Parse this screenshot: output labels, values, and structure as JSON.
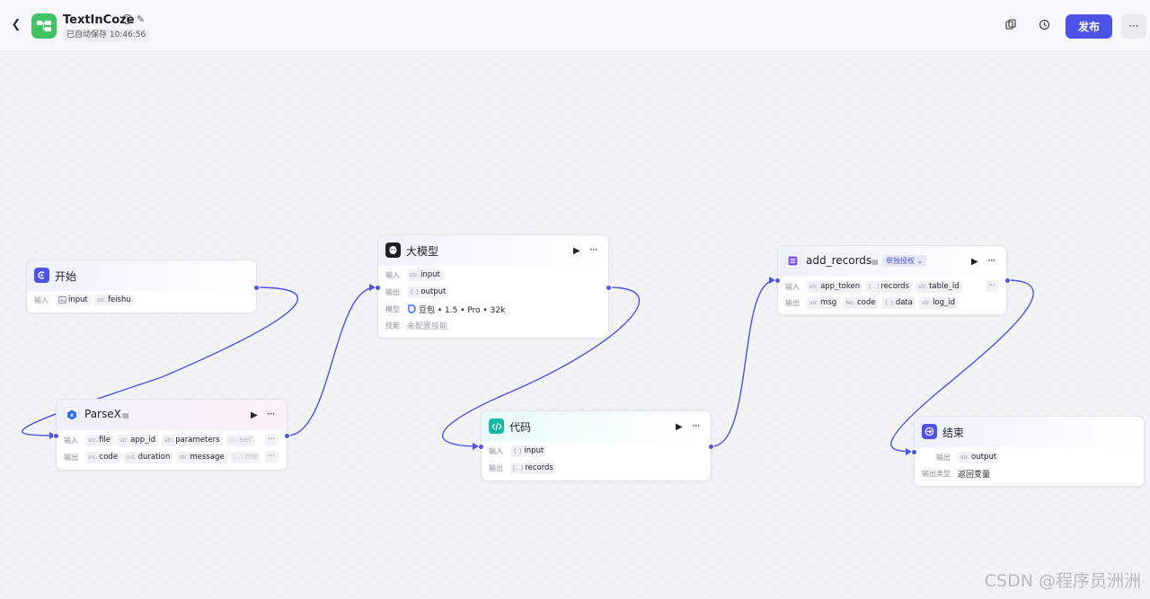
{
  "header": {
    "title": "TextInCoze",
    "autosave": "已自动保存 10:46:56",
    "publish_label": "发布"
  },
  "colors": {
    "accent": "#4d53e8",
    "start": "#4d53e8",
    "llm": "#1d1f29",
    "code": "#16b8a6",
    "table": "#7b4ff2",
    "end": "#4d53e8"
  },
  "icons": [
    "back-icon",
    "app-logo-icon",
    "info-icon",
    "edit-icon",
    "copy-icon",
    "history-icon",
    "more-icon",
    "play-icon"
  ],
  "nodes": {
    "start": {
      "title": "开始",
      "input_label": "输入",
      "inputs": [
        {
          "type": "",
          "name": "input"
        },
        {
          "type": "str.",
          "name": "feishu"
        }
      ]
    },
    "parsex": {
      "title": "ParseX",
      "input_label": "输入",
      "output_label": "输出",
      "inputs": [
        {
          "type": "str.",
          "name": "file"
        },
        {
          "type": "str.",
          "name": "app_id"
        },
        {
          "type": "str.",
          "name": "parameters"
        },
        {
          "type": "str.",
          "name": "sec"
        }
      ],
      "outputs": [
        {
          "type": "int.",
          "name": "code"
        },
        {
          "type": "int.",
          "name": "duration"
        },
        {
          "type": "str.",
          "name": "message"
        },
        {
          "type": "[...]",
          "name": "me"
        }
      ],
      "more": "···"
    },
    "llm": {
      "title": "大模型",
      "input_label": "输入",
      "output_label": "输出",
      "model_label": "模型",
      "skill_label": "技能",
      "input": {
        "type": "str.",
        "name": "input"
      },
      "output": {
        "type": "{ }",
        "name": "output"
      },
      "model_value": "豆包 • 1.5 • Pro • 32k",
      "skill_value": "未配置技能"
    },
    "code": {
      "title": "代码",
      "input_label": "输入",
      "output_label": "输出",
      "input": {
        "type": "{ }",
        "name": "input"
      },
      "output": {
        "type": "[...]",
        "name": "records"
      }
    },
    "add_records": {
      "title": "add_records",
      "tag": "单独授权",
      "input_label": "输入",
      "output_label": "输出",
      "inputs": [
        {
          "type": "str.",
          "name": "app_token"
        },
        {
          "type": "[...]",
          "name": "records"
        },
        {
          "type": "str.",
          "name": "table_id"
        }
      ],
      "outputs": [
        {
          "type": "str.",
          "name": "msg"
        },
        {
          "type": "No.",
          "name": "code"
        },
        {
          "type": "{ }",
          "name": "data"
        },
        {
          "type": "str.",
          "name": "log_id"
        }
      ],
      "more": "···"
    },
    "end": {
      "title": "结束",
      "output_label": "输出",
      "output_type_label": "输出类型",
      "output": {
        "type": "str.",
        "name": "output"
      },
      "output_type_value": "返回变量"
    }
  },
  "watermark": "CSDN @程序员洲洲"
}
